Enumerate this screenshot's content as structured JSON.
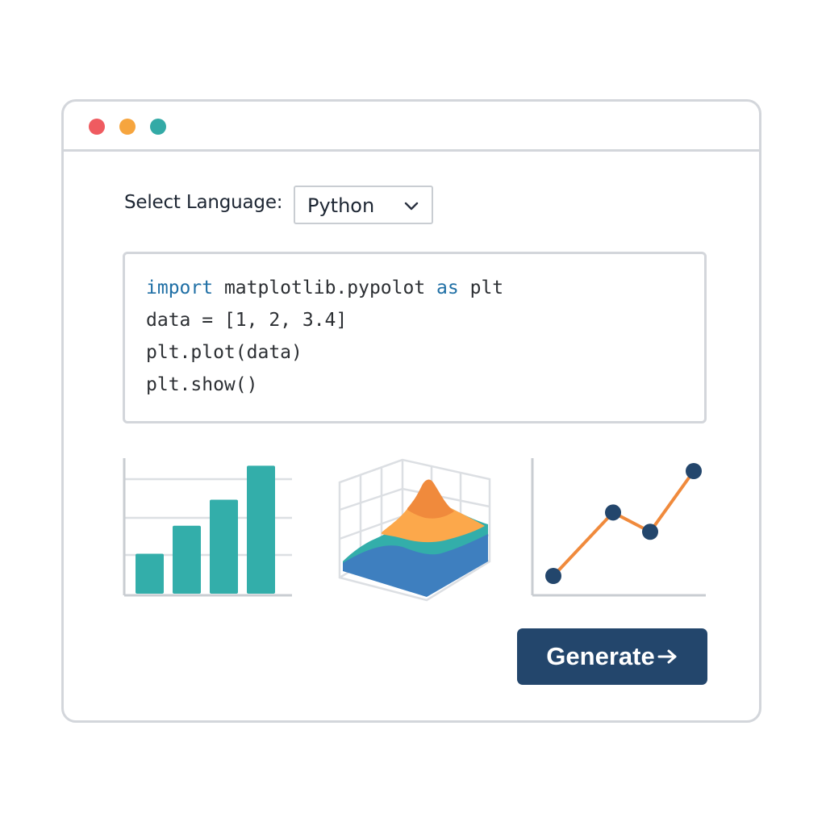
{
  "window": {
    "controls": [
      {
        "name": "close",
        "color": "#ef5b60"
      },
      {
        "name": "minimize",
        "color": "#f6a53e"
      },
      {
        "name": "maximize",
        "color": "#33aaa6"
      }
    ]
  },
  "language": {
    "label": "Select Language:",
    "selected": "Python",
    "icon": "chevron-down-icon"
  },
  "code": {
    "lines": [
      [
        {
          "t": "import",
          "kw": true
        },
        {
          "t": " matplotlib.pypolot "
        },
        {
          "t": "as",
          "kw": true
        },
        {
          "t": " plt"
        }
      ],
      [
        {
          "t": "data = [1, 2, 3.4]"
        }
      ],
      [
        {
          "t": "plt.plot(data)"
        }
      ],
      [
        {
          "t": "plt.show()"
        }
      ]
    ]
  },
  "colors": {
    "teal": "#33aeaa",
    "orange": "#f08a3c",
    "light_orange": "#fca84b",
    "blue": "#3e7fbf",
    "navy": "#23466c",
    "axis": "#c9cdd2",
    "code_keyword": "#1f6fa5"
  },
  "illustrations": [
    {
      "kind": "bar-chart-icon",
      "values": [
        1,
        1.7,
        2.35,
        3.2
      ]
    },
    {
      "kind": "surface-plot-icon"
    },
    {
      "kind": "line-chart-icon",
      "values": [
        1,
        3.3,
        2.6,
        4.8
      ]
    }
  ],
  "generate_button": {
    "label": "Generate",
    "icon": "arrow-right-icon"
  }
}
